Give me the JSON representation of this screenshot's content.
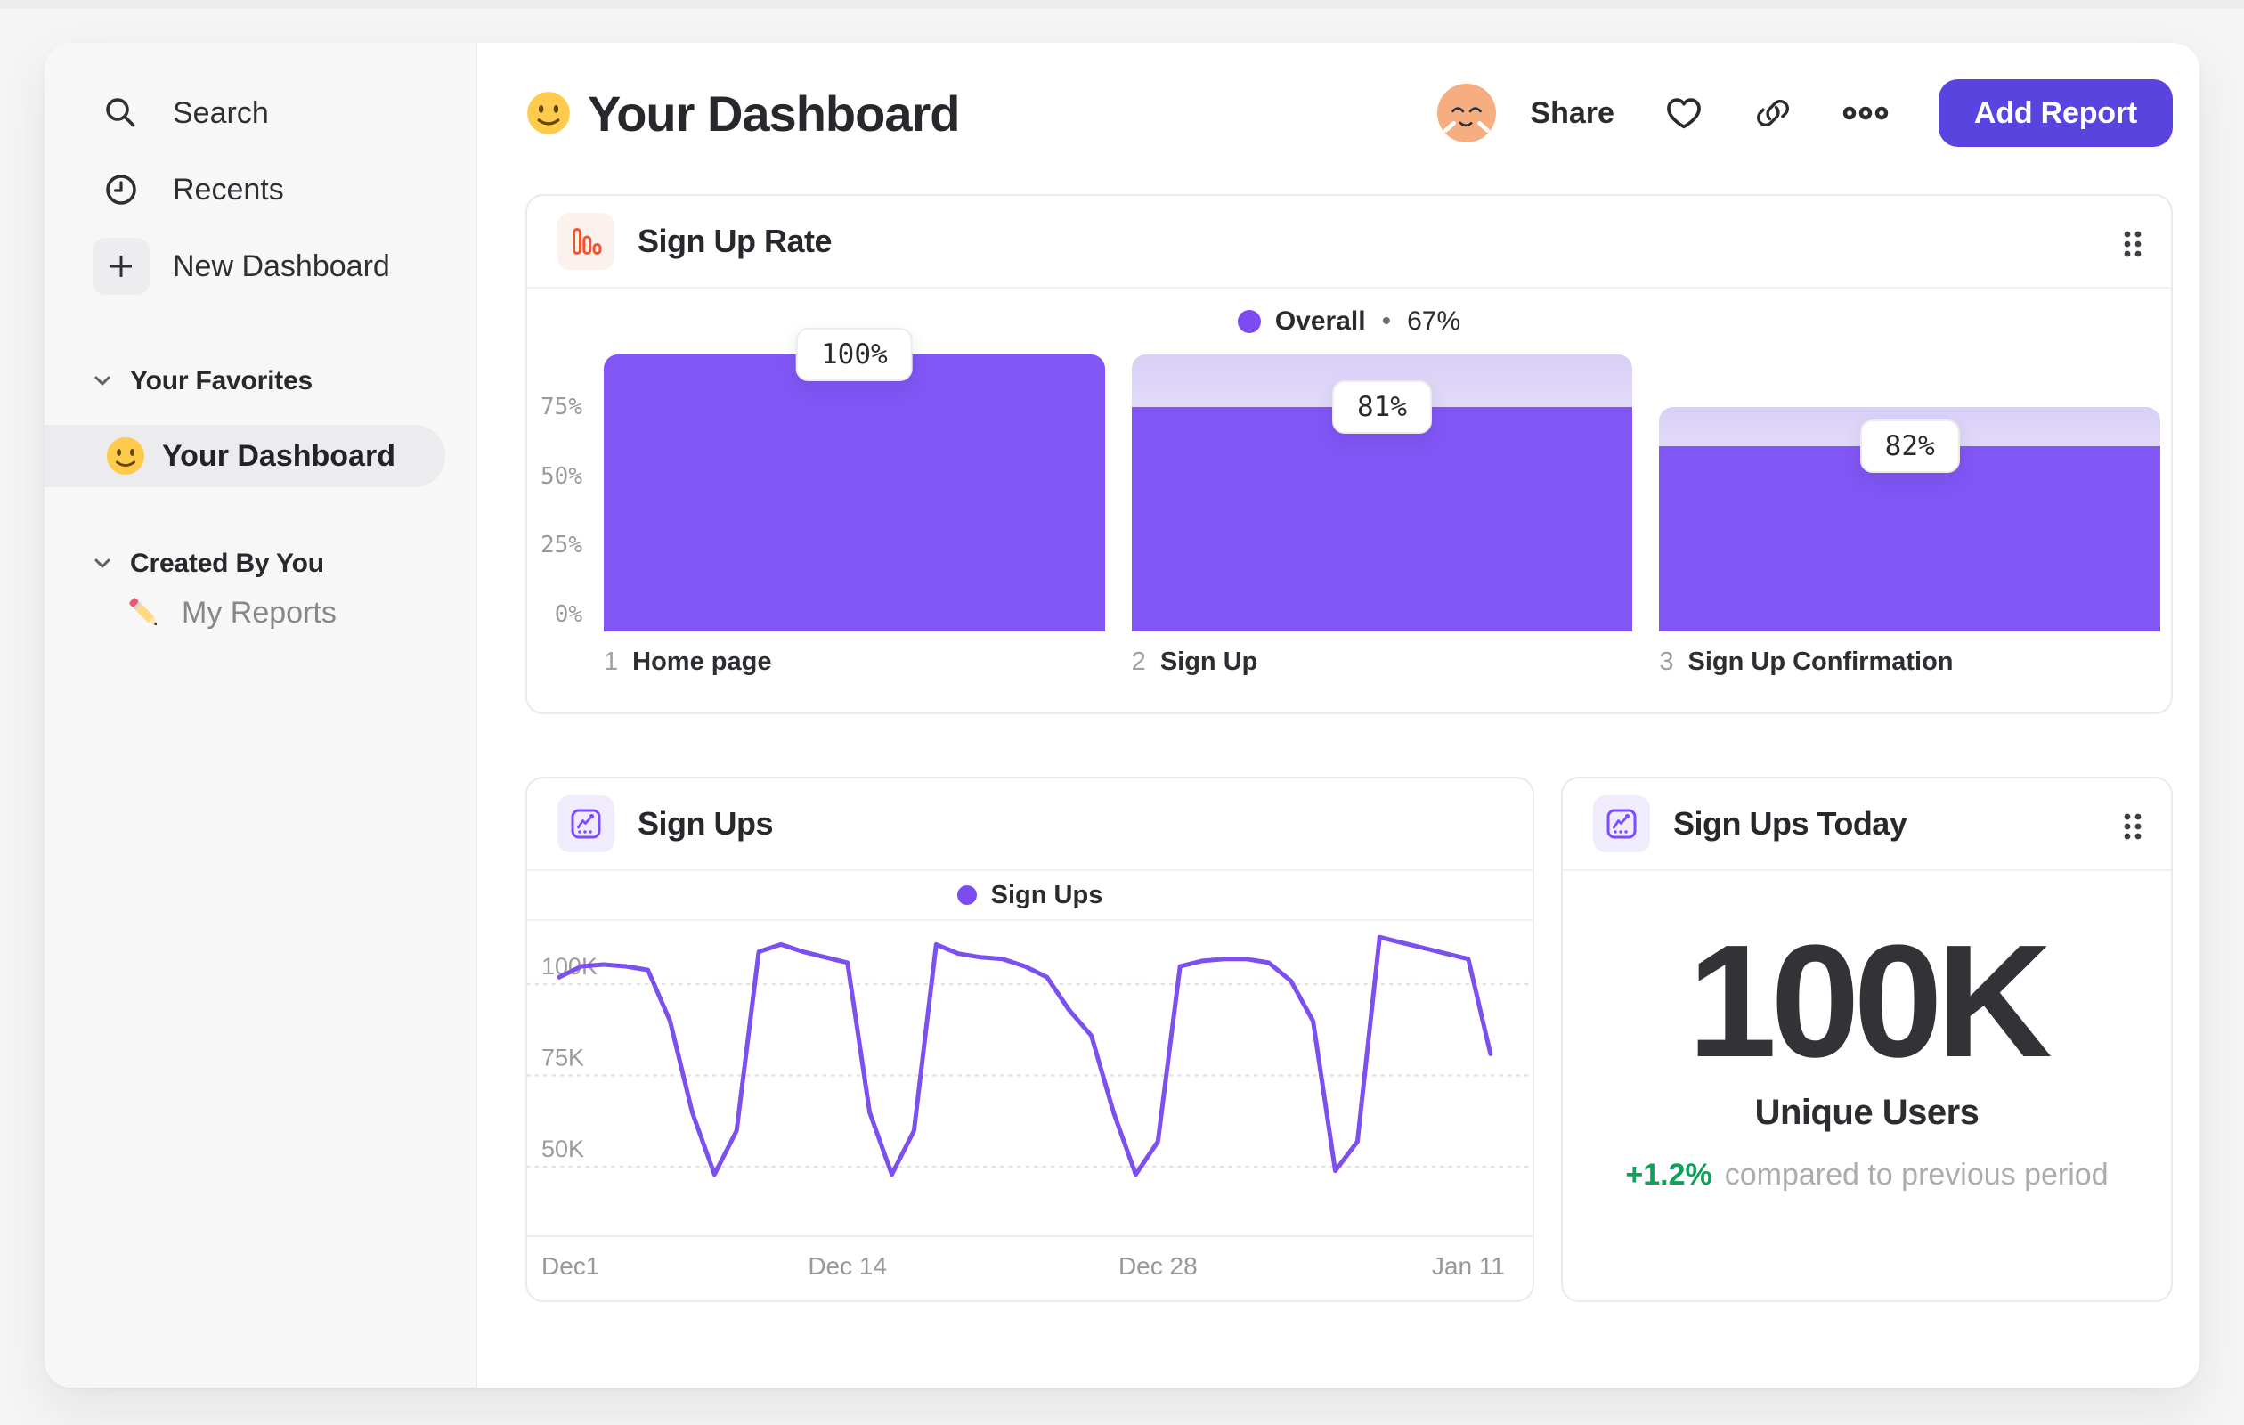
{
  "colors": {
    "accent_purple": "#8156F6",
    "line_purple": "#7B50EE",
    "legend_dot": "#7C4BF2",
    "button_indigo": "#5A44E0",
    "icon_orange": "#F2542D",
    "icon_purple": "#7C4DFF",
    "delta_green": "#0CA259"
  },
  "sidebar": {
    "items": [
      {
        "label": "Search"
      },
      {
        "label": "Recents"
      },
      {
        "label": "New Dashboard"
      }
    ],
    "sections": [
      {
        "label": "Your Favorites",
        "items": [
          {
            "label": "Your Dashboard",
            "active": true
          }
        ]
      },
      {
        "label": "Created By You",
        "items": [
          {
            "label": "My Reports",
            "active": false
          }
        ]
      }
    ]
  },
  "header": {
    "title": "Your Dashboard",
    "share_label": "Share",
    "add_report_label": "Add Report"
  },
  "cards": {
    "sign_up_rate": {
      "title": "Sign Up Rate"
    },
    "sign_ups": {
      "title": "Sign Ups"
    },
    "sign_ups_today": {
      "title": "Sign Ups Today",
      "value": "100K",
      "subtitle": "Unique Users",
      "delta": "+1.2%",
      "delta_note": "compared to previous period"
    }
  },
  "chart_data": [
    {
      "id": "sign_up_rate_funnel",
      "type": "bar",
      "title": "Sign Up Rate",
      "legend": {
        "label": "Overall",
        "separator": "•",
        "value": "67%",
        "position": "top-center"
      },
      "step_numbers": [
        "1",
        "2",
        "3"
      ],
      "categories": [
        "Home page",
        "Sign Up",
        "Sign Up Confirmation"
      ],
      "values": [
        100,
        81,
        82
      ],
      "value_labels": [
        "100%",
        "81%",
        "82%"
      ],
      "overall_values": [
        100,
        81,
        67
      ],
      "ylim": [
        0,
        100
      ],
      "yticks": [
        {
          "label": "75%",
          "value": 75
        },
        {
          "label": "50%",
          "value": 50
        },
        {
          "label": "25%",
          "value": 25
        },
        {
          "label": "0%",
          "value": 0
        }
      ],
      "grid": false,
      "bar_color": "#8156F6"
    },
    {
      "id": "sign_ups_line",
      "type": "line",
      "title": "Sign Ups",
      "legend": {
        "label": "Sign Ups",
        "position": "top-center"
      },
      "unit": "K",
      "values_k": [
        97,
        100,
        100.5,
        100,
        99,
        85,
        60,
        43,
        55,
        104,
        106,
        104,
        102.5,
        101,
        60,
        43,
        55,
        106,
        103.5,
        102.5,
        102,
        100,
        97,
        88,
        81,
        60,
        43,
        52,
        100,
        101.5,
        102,
        102,
        101,
        96,
        85,
        44,
        52,
        108,
        106.5,
        105,
        103.5,
        102,
        76
      ],
      "x_is_days_from": "Dec 1",
      "xticks": [
        {
          "label": "Dec1",
          "day": 0
        },
        {
          "label": "Dec 14",
          "day": 13
        },
        {
          "label": "Dec 28",
          "day": 27
        },
        {
          "label": "Jan 11",
          "day": 41
        }
      ],
      "yticks": [
        {
          "label": "100K",
          "value": 100
        },
        {
          "label": "75K",
          "value": 75
        },
        {
          "label": "50K",
          "value": 50
        }
      ],
      "ylim": [
        30,
        112
      ],
      "grid": "dashed-horizontal",
      "line_color": "#7B50EE"
    }
  ]
}
